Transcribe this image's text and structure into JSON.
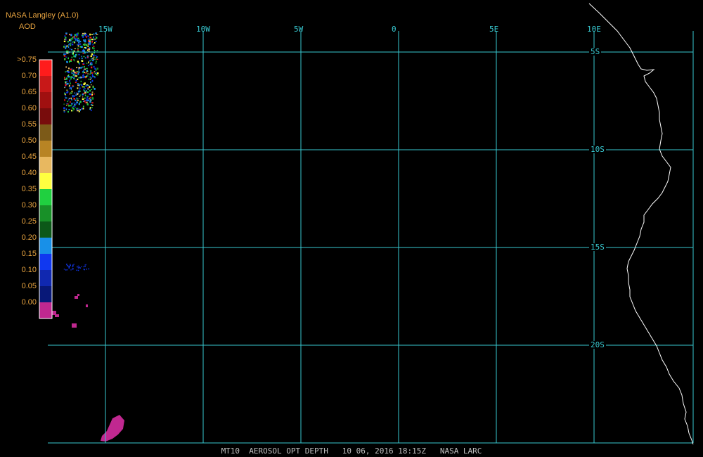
{
  "header": {
    "title": "NASA Langley (A1.0)",
    "subtitle": "AOD"
  },
  "legend": {
    "entries": [
      {
        "label": ">0.75",
        "color": "#ff1c1c"
      },
      {
        "label": "0.70",
        "color": "#c81818"
      },
      {
        "label": "0.65",
        "color": "#a01010"
      },
      {
        "label": "0.60",
        "color": "#780c0c"
      },
      {
        "label": "0.55",
        "color": "#7c5a18"
      },
      {
        "label": "0.50",
        "color": "#b88424"
      },
      {
        "label": "0.45",
        "color": "#e8b860"
      },
      {
        "label": "0.40",
        "color": "#ffff40"
      },
      {
        "label": "0.35",
        "color": "#20d040"
      },
      {
        "label": "0.30",
        "color": "#189028"
      },
      {
        "label": "0.25",
        "color": "#0c5818"
      },
      {
        "label": "0.20",
        "color": "#1890e8"
      },
      {
        "label": "0.15",
        "color": "#1038f0"
      },
      {
        "label": "0.10",
        "color": "#1028b0"
      },
      {
        "label": "0.05",
        "color": "#081878"
      },
      {
        "label": "0.00",
        "color": "#c02890"
      }
    ]
  },
  "grid": {
    "longitudes": [
      {
        "deg": -15,
        "label": "15W"
      },
      {
        "deg": -10,
        "label": "10W"
      },
      {
        "deg": -5,
        "label": "5W"
      },
      {
        "deg": 0,
        "label": "0"
      },
      {
        "deg": 5,
        "label": "5E"
      },
      {
        "deg": 10,
        "label": "10E"
      }
    ],
    "latitudes": [
      {
        "deg": -5,
        "label": "5S"
      },
      {
        "deg": -10,
        "label": "10S"
      },
      {
        "deg": -15,
        "label": "15S"
      },
      {
        "deg": -20,
        "label": "20S"
      }
    ],
    "grid_color": "#38c8d0",
    "coast_color": "#ffffff"
  },
  "footer": {
    "text": "MT10  AEROSOL OPT DEPTH   10 06, 2016 18:15Z   NASA LARC"
  }
}
